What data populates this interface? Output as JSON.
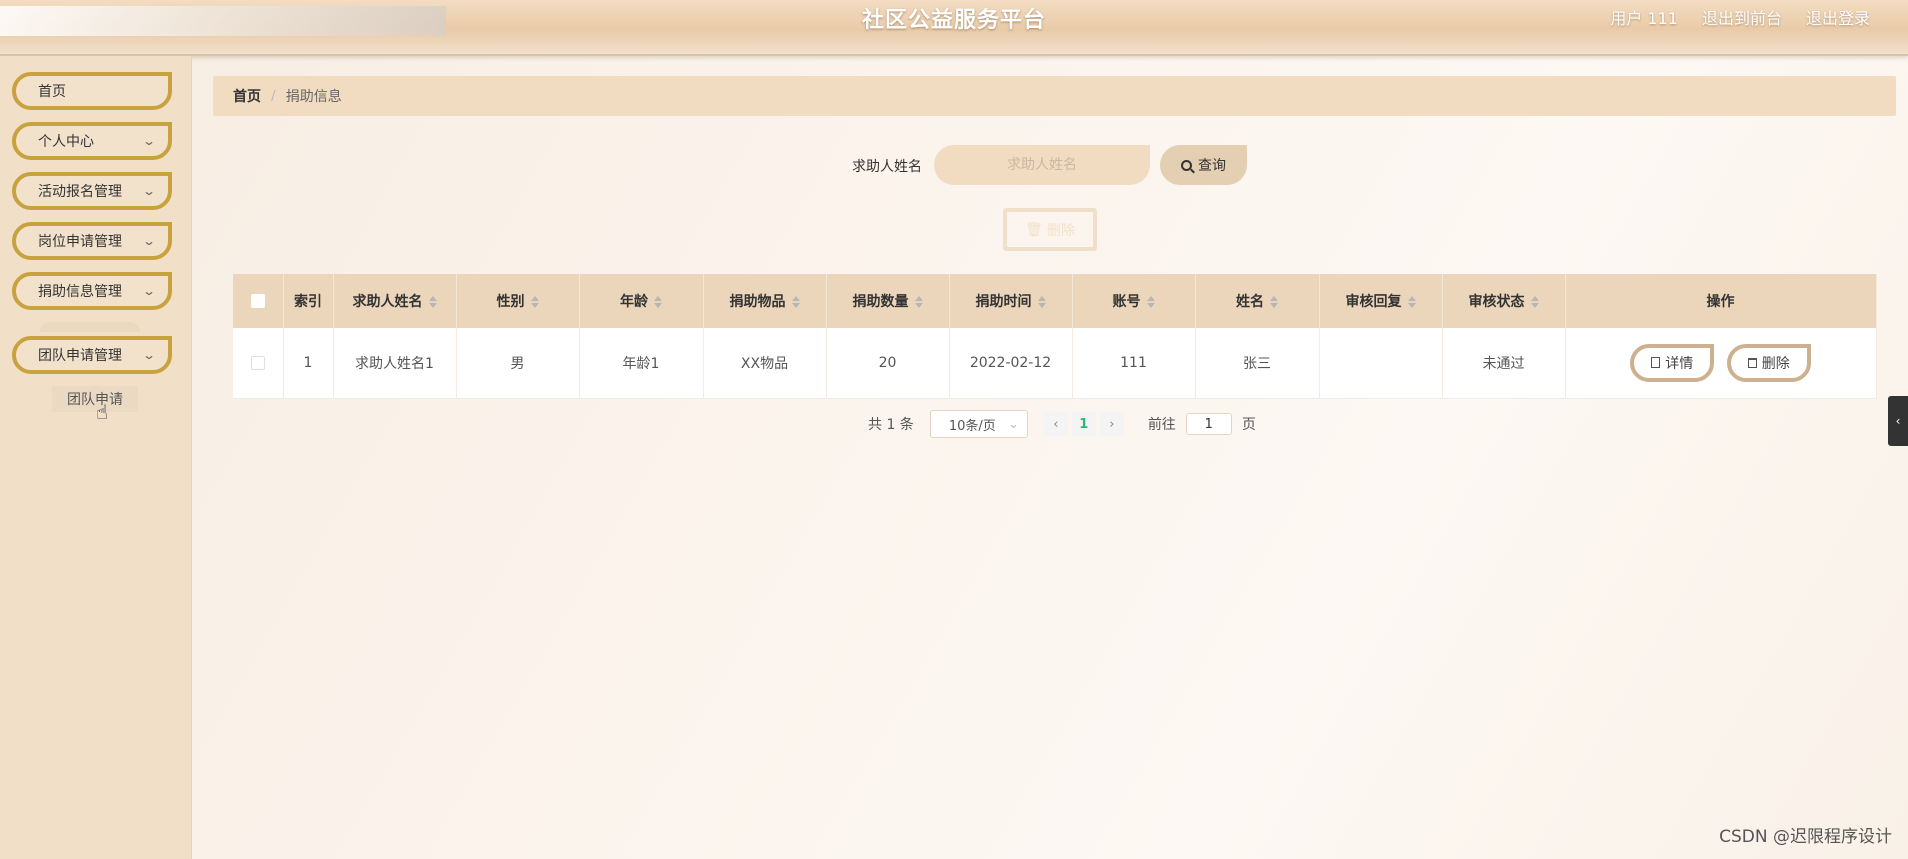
{
  "header": {
    "title": "社区公益服务平台",
    "user": "用户 111",
    "front": "退出到前台",
    "logout": "退出登录"
  },
  "sidebar": {
    "items": [
      {
        "label": "首页",
        "has_arrow": false
      },
      {
        "label": "个人中心",
        "has_arrow": true
      },
      {
        "label": "活动报名管理",
        "has_arrow": true
      },
      {
        "label": "岗位申请管理",
        "has_arrow": true
      },
      {
        "label": "捐助信息管理",
        "has_arrow": true
      },
      {
        "label": "团队申请管理",
        "has_arrow": true
      }
    ],
    "submenu": "团队申请"
  },
  "breadcrumb": {
    "home": "首页",
    "separator": "/",
    "current": "捐助信息"
  },
  "search": {
    "label": "求助人姓名",
    "placeholder": "求助人姓名",
    "button": "查询",
    "batch_delete": "删除"
  },
  "table": {
    "columns": [
      "索引",
      "求助人姓名",
      "性别",
      "年龄",
      "捐助物品",
      "捐助数量",
      "捐助时间",
      "账号",
      "姓名",
      "审核回复",
      "审核状态",
      "操作"
    ],
    "rows": [
      {
        "index": "1",
        "name": "求助人姓名1",
        "gender": "男",
        "age": "年龄1",
        "item": "XX物品",
        "quantity": "20",
        "time": "2022-02-12",
        "account": "111",
        "real_name": "张三",
        "reply": "",
        "status": "未通过",
        "detail_btn": "详情",
        "delete_btn": "删除"
      }
    ]
  },
  "pagination": {
    "total": "共 1 条",
    "page_size": "10条/页",
    "current_page": "1",
    "goto_label": "前往",
    "goto_value": "1",
    "page_suffix": "页"
  },
  "watermark": "CSDN @迟限程序设计",
  "colors": {
    "accent_border": "#c9a240",
    "header_bg": "#e9cba8",
    "table_header": "#ecd6bb",
    "active_page": "#2db67c"
  }
}
